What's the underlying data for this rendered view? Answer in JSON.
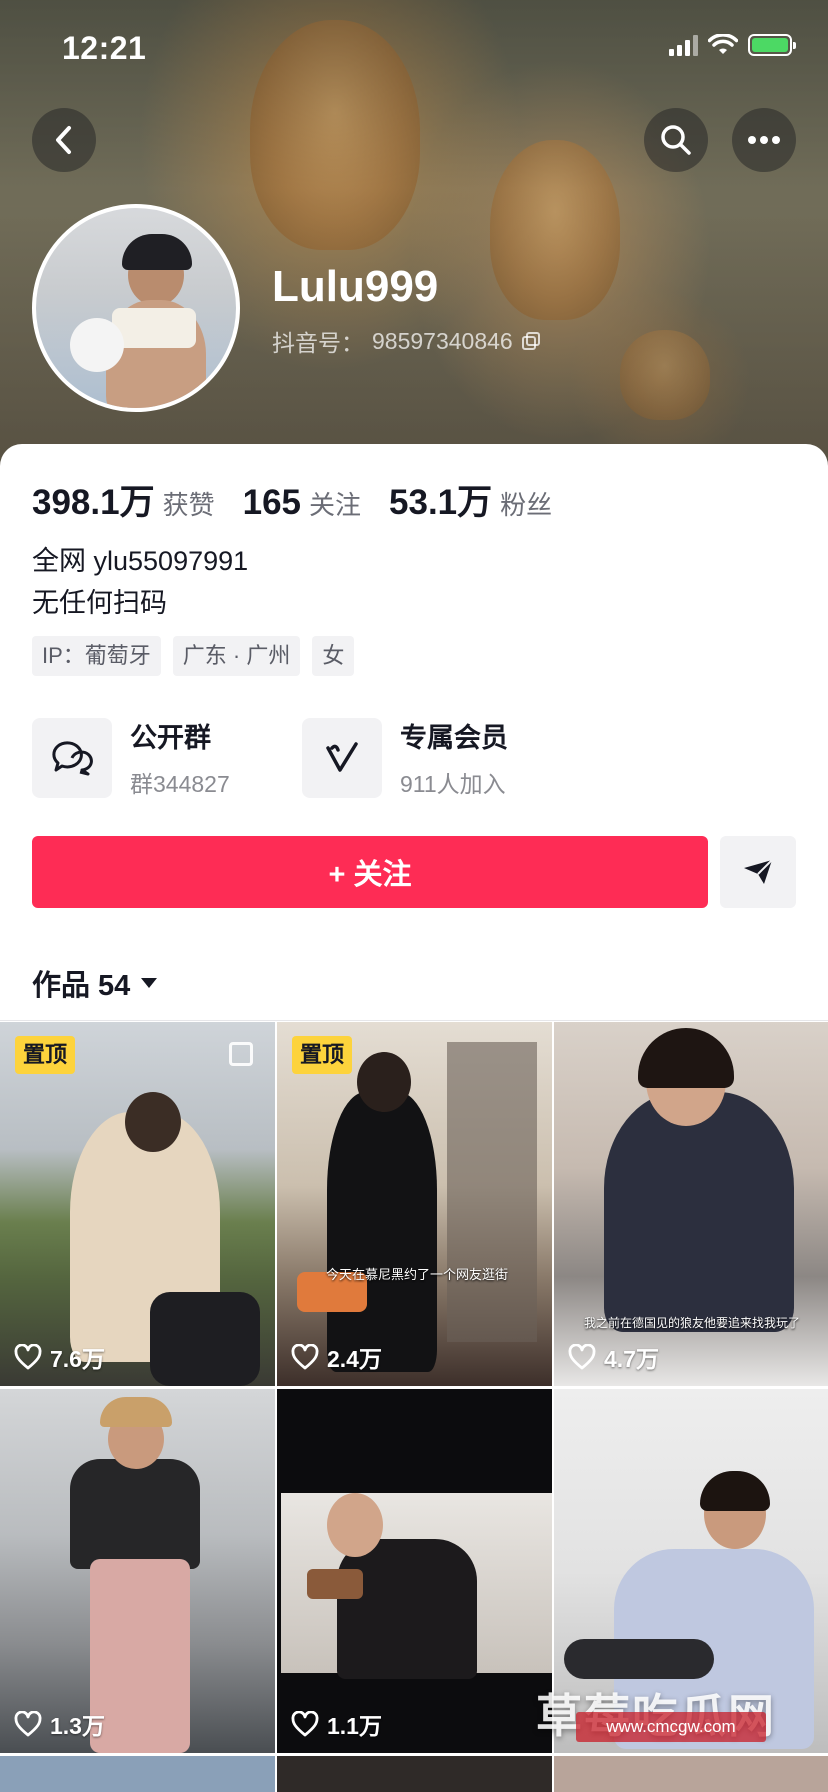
{
  "status_bar": {
    "time": "12:21"
  },
  "header": {
    "username": "Lulu999",
    "douyin_id_label": "抖音号：",
    "douyin_id": "98597340846"
  },
  "stats": [
    {
      "value": "398.1万",
      "label": "获赞"
    },
    {
      "value": "165",
      "label": "关注"
    },
    {
      "value": "53.1万",
      "label": "粉丝"
    }
  ],
  "bio": [
    "全网 ylu55097991",
    "无任何扫码"
  ],
  "tags": [
    "IP：葡萄牙",
    "广东 · 广州",
    "女"
  ],
  "features": [
    {
      "title": "公开群",
      "subtitle": "群344827",
      "icon": "chat-bubbles-icon"
    },
    {
      "title": "专属会员",
      "subtitle": "911人加入",
      "icon": "vip-v-icon"
    }
  ],
  "actions": {
    "follow_label": "+ 关注",
    "share_icon": "send-arrow-icon"
  },
  "works": {
    "label": "作品 54"
  },
  "videos": [
    {
      "likes": "7.6万",
      "pinned_label": "置顶",
      "multi": true
    },
    {
      "likes": "2.4万",
      "pinned_label": "置顶",
      "caption": "今天在慕尼黑约了一个网友逛街"
    },
    {
      "likes": "4.7万",
      "caption": "我之前在德国见的狼友他要追来找我玩了"
    },
    {
      "likes": "1.3万"
    },
    {
      "likes": "1.1万"
    },
    {
      "likes": ""
    }
  ],
  "watermark": {
    "title": "草莓吃瓜网",
    "url": "www.cmcgw.com"
  },
  "colors": {
    "accent": "#fe2c55",
    "pin": "#fdd33c",
    "battery": "#4cd964"
  }
}
